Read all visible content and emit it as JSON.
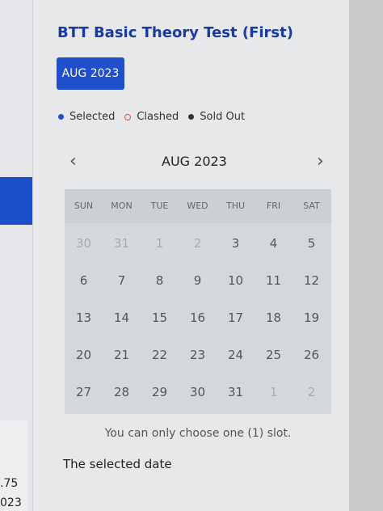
{
  "background": {
    "numbers": [
      ".75",
      "023"
    ]
  },
  "panel": {
    "title": "BTT Basic Theory Test (First)",
    "month_button": "AUG 2023",
    "legend": [
      {
        "label": "Selected",
        "icon": "filled-blue-dot"
      },
      {
        "label": "Clashed",
        "icon": "hollow-red-dot"
      },
      {
        "label": "Sold Out",
        "icon": "filled-black-dot"
      }
    ],
    "calendar": {
      "month_label": "AUG 2023",
      "prev_icon": "‹",
      "next_icon": "›",
      "weekdays": [
        "SUN",
        "MON",
        "TUE",
        "WED",
        "THU",
        "FRI",
        "SAT"
      ],
      "weeks": [
        [
          {
            "d": "30",
            "m": true
          },
          {
            "d": "31",
            "m": true
          },
          {
            "d": "1",
            "m": true
          },
          {
            "d": "2",
            "m": true
          },
          {
            "d": "3",
            "m": false
          },
          {
            "d": "4",
            "m": false
          },
          {
            "d": "5",
            "m": false
          }
        ],
        [
          {
            "d": "6",
            "m": false
          },
          {
            "d": "7",
            "m": false
          },
          {
            "d": "8",
            "m": false
          },
          {
            "d": "9",
            "m": false
          },
          {
            "d": "10",
            "m": false
          },
          {
            "d": "11",
            "m": false
          },
          {
            "d": "12",
            "m": false
          }
        ],
        [
          {
            "d": "13",
            "m": false
          },
          {
            "d": "14",
            "m": false
          },
          {
            "d": "15",
            "m": false
          },
          {
            "d": "16",
            "m": false
          },
          {
            "d": "17",
            "m": false
          },
          {
            "d": "18",
            "m": false
          },
          {
            "d": "19",
            "m": false
          }
        ],
        [
          {
            "d": "20",
            "m": false
          },
          {
            "d": "21",
            "m": false
          },
          {
            "d": "22",
            "m": false
          },
          {
            "d": "23",
            "m": false
          },
          {
            "d": "24",
            "m": false
          },
          {
            "d": "25",
            "m": false
          },
          {
            "d": "26",
            "m": false
          }
        ],
        [
          {
            "d": "27",
            "m": false
          },
          {
            "d": "28",
            "m": false
          },
          {
            "d": "29",
            "m": false
          },
          {
            "d": "30",
            "m": false
          },
          {
            "d": "31",
            "m": false
          },
          {
            "d": "1",
            "m": true
          },
          {
            "d": "2",
            "m": true
          }
        ]
      ]
    },
    "note": "You can only choose one (1) slot.",
    "selected_label": "The selected date"
  },
  "colors": {
    "accent": "#1f4fcb",
    "title": "#1a3a9e",
    "clashed": "#d9534f"
  }
}
